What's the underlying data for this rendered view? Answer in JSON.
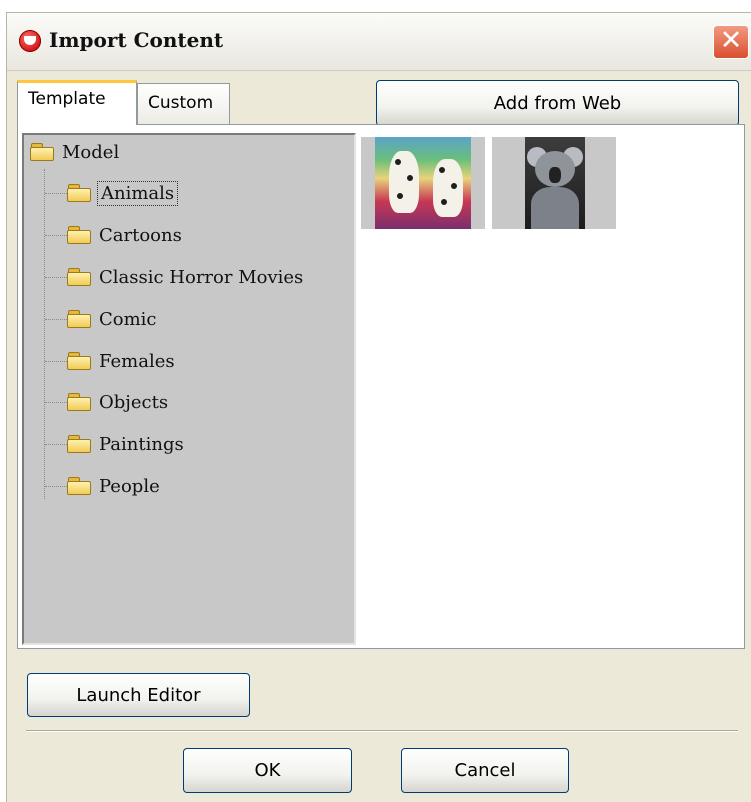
{
  "window": {
    "title": "Import Content",
    "close_glyph": "✕"
  },
  "tabs": [
    {
      "label": "Template",
      "selected": true
    },
    {
      "label": "Custom",
      "selected": false
    }
  ],
  "buttons": {
    "add_from_web": "Add from Web",
    "launch_editor": "Launch Editor",
    "ok": "OK",
    "cancel": "Cancel"
  },
  "tree": {
    "root": "Model",
    "selected": "Animals",
    "items": [
      "Animals",
      "Cartoons",
      "Classic Horror Movies",
      "Comic",
      "Females",
      "Objects",
      "Paintings",
      "People"
    ]
  },
  "thumbnails": [
    {
      "subject": "dalmatian puppies"
    },
    {
      "subject": "koala"
    }
  ],
  "icons": {
    "app": "app-logo-icon",
    "folder": "folder-icon",
    "close": "close-icon"
  },
  "colors": {
    "tab_accent": "#ffc83c",
    "close_button": "#d8502f",
    "button_border": "#003c74"
  }
}
